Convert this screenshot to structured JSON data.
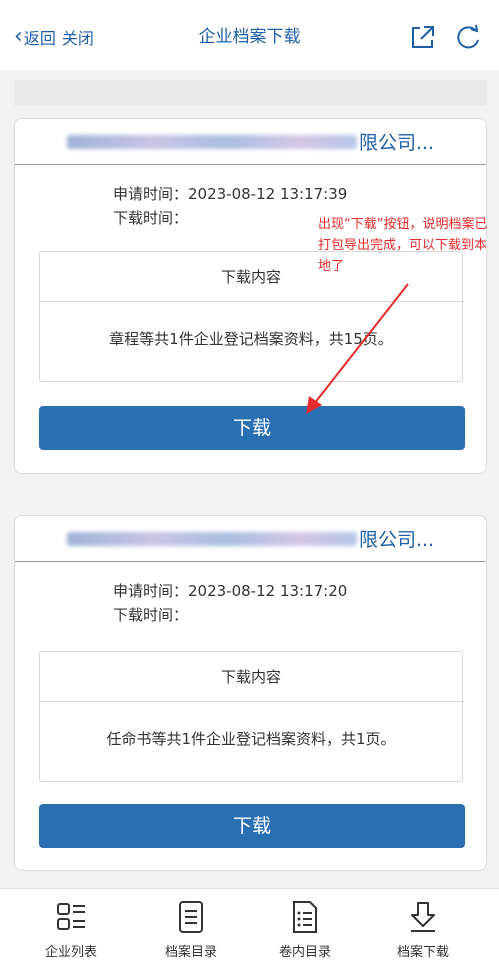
{
  "header": {
    "back_label": "返回",
    "close_label": "关闭",
    "title": "企业档案下载"
  },
  "cards": [
    {
      "company_suffix": "限公司...",
      "apply_time": "申请时间：2023-08-12 13:17:39",
      "download_time": "下载时间：",
      "content_header": "下载内容",
      "content_body": "章程等共1件企业登记档案资料，共15页。",
      "button_label": "下载"
    },
    {
      "company_suffix": "限公司...",
      "apply_time": "申请时间：2023-08-12 13:17:20",
      "download_time": "下载时间：",
      "content_header": "下载内容",
      "content_body": "任命书等共1件企业登记档案资料，共1页。",
      "button_label": "下载"
    }
  ],
  "annotation": {
    "text": "出现“下载”按钮，说明档案已打包导出完成，可以下载到本地了",
    "color": "#e52b2b"
  },
  "bottom_nav": [
    {
      "label": "企业列表",
      "icon": "company-list-icon"
    },
    {
      "label": "档案目录",
      "icon": "archive-catalog-icon"
    },
    {
      "label": "卷内目录",
      "icon": "volume-catalog-icon"
    },
    {
      "label": "档案下载",
      "icon": "archive-download-icon"
    }
  ],
  "colors": {
    "accent": "#1f5fa8",
    "button": "#2b6fb3"
  }
}
